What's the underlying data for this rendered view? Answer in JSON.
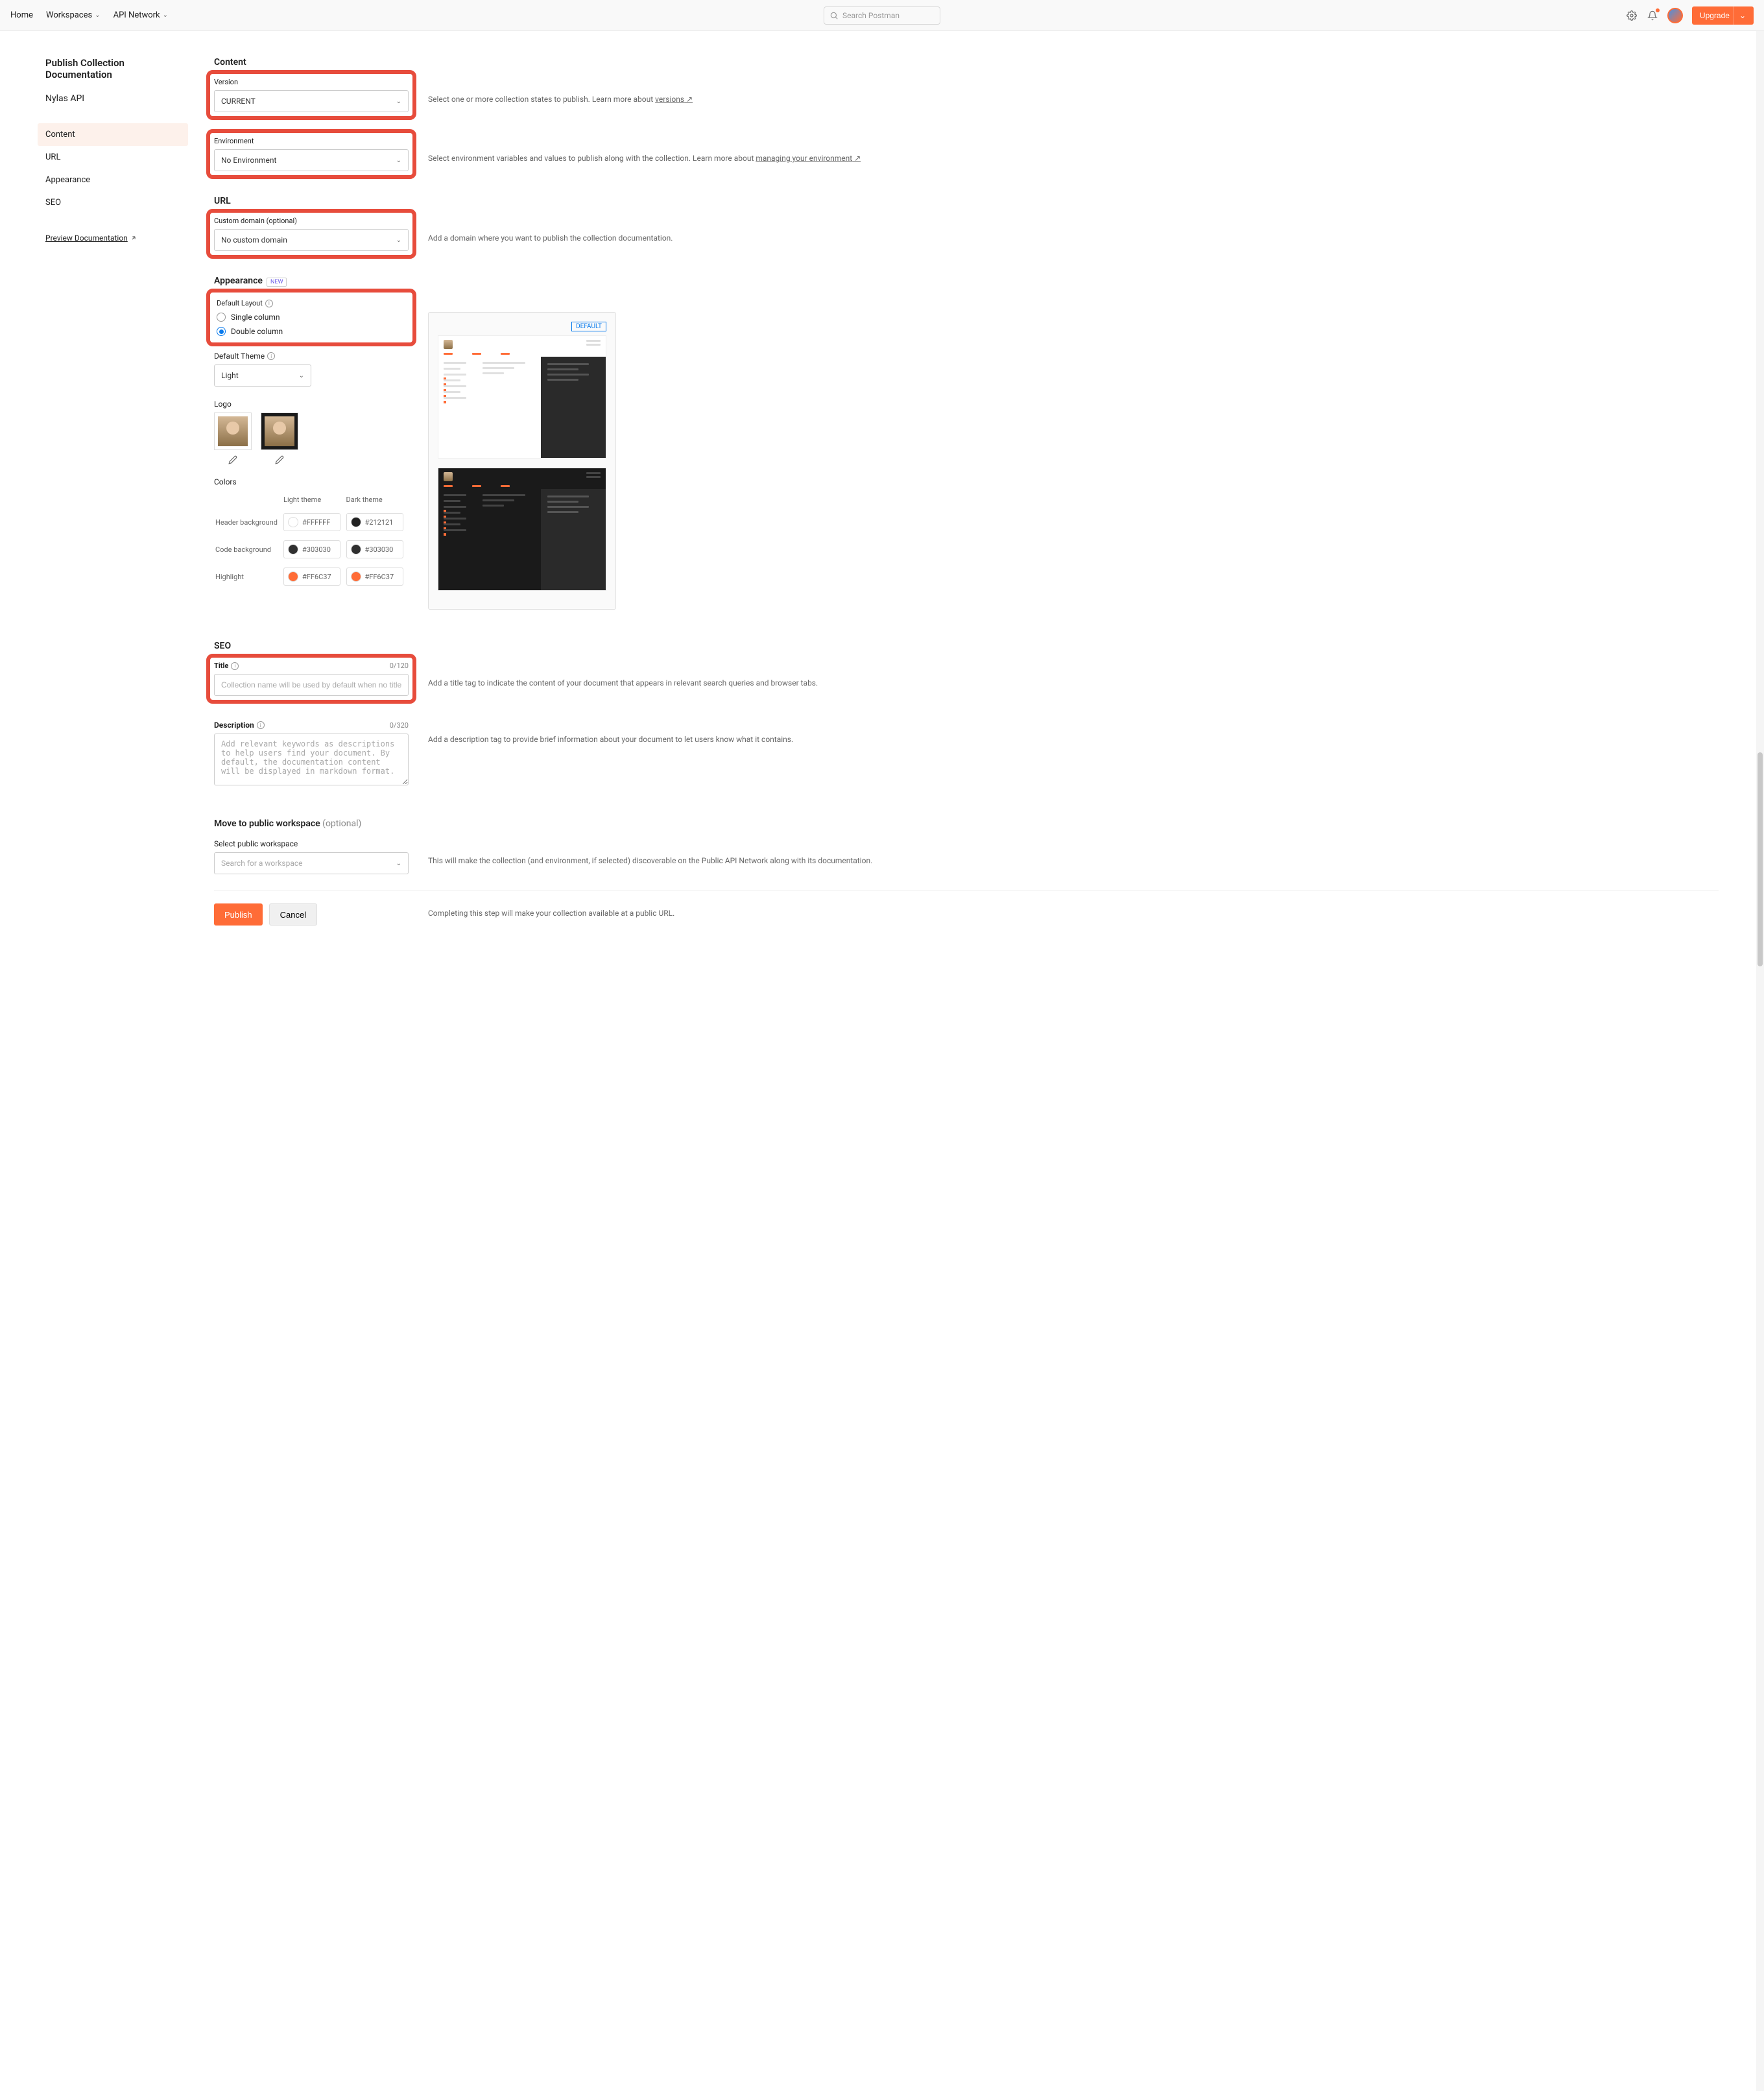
{
  "header": {
    "home": "Home",
    "workspaces": "Workspaces",
    "apiNetwork": "API Network",
    "searchPlaceholder": "Search Postman",
    "upgrade": "Upgrade"
  },
  "sidebar": {
    "title": "Publish Collection Documentation",
    "apiName": "Nylas API",
    "nav": {
      "content": "Content",
      "url": "URL",
      "appearance": "Appearance",
      "seo": "SEO"
    },
    "preview": "Preview Documentation"
  },
  "content": {
    "title": "Content",
    "versionLabel": "Version",
    "versionValue": "CURRENT",
    "versionInfo": "Select one or more collection states to publish. Learn more about ",
    "versionsLink": "versions",
    "envLabel": "Environment",
    "envValue": "No Environment",
    "envInfo": "Select environment variables and values to publish along with the collection. Learn more about ",
    "envLink": "managing your environment"
  },
  "url": {
    "title": "URL",
    "domainLabel": "Custom domain (optional)",
    "domainValue": "No custom domain",
    "domainInfo": "Add a domain where you want to publish the collection documentation."
  },
  "appearance": {
    "title": "Appearance",
    "newBadge": "NEW",
    "layoutLabel": "Default Layout",
    "singleColumn": "Single column",
    "doubleColumn": "Double column",
    "themeLabel": "Default Theme",
    "themeValue": "Light",
    "logoLabel": "Logo",
    "colorsLabel": "Colors",
    "lightTheme": "Light theme",
    "darkTheme": "Dark theme",
    "headerBg": "Header background",
    "codeBg": "Code background",
    "highlight": "Highlight",
    "defaultBadge": "DEFAULT",
    "colors": {
      "headerLight": "#FFFFFF",
      "headerDark": "#212121",
      "codeLight": "#303030",
      "codeDark": "#303030",
      "hlLight": "#FF6C37",
      "hlDark": "#FF6C37"
    }
  },
  "seo": {
    "title": "SEO",
    "titleLabel": "Title",
    "titleCount": "0/120",
    "titlePlaceholder": "Collection name will be used by default when no title is entered.",
    "titleInfo": "Add a title tag to indicate the content of your document that appears in relevant search queries and browser tabs.",
    "descLabel": "Description",
    "descCount": "0/320",
    "descPlaceholder": "Add relevant keywords as descriptions to help users find your document. By default, the documentation content will be displayed in markdown format.",
    "descInfo": "Add a description tag to provide brief information about your document to let users know what it contains."
  },
  "workspace": {
    "title": "Move to public workspace",
    "optional": "(optional)",
    "selectLabel": "Select public workspace",
    "placeholder": "Search for a workspace",
    "info": "This will make the collection (and environment, if selected) discoverable on the Public API Network along with its documentation."
  },
  "footer": {
    "publish": "Publish",
    "cancel": "Cancel",
    "info": "Completing this step will make your collection available at a public URL."
  }
}
